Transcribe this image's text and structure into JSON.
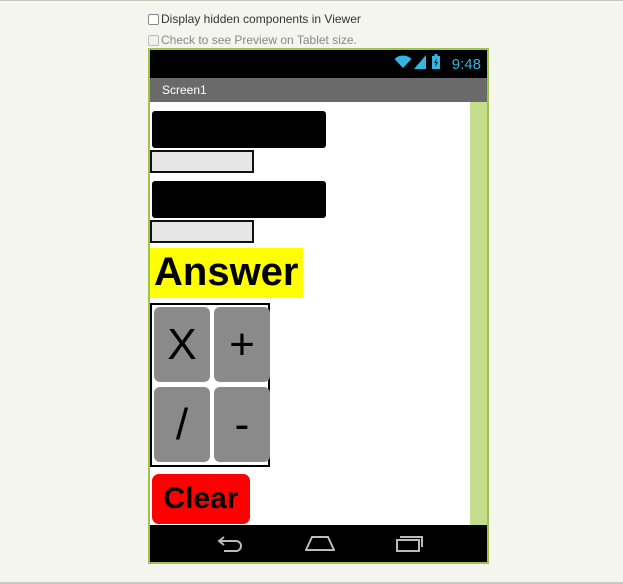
{
  "options": {
    "hidden_components_label": "Display hidden components in Viewer",
    "tablet_preview_label": "Check to see Preview on Tablet size."
  },
  "status_bar": {
    "time": "9:48"
  },
  "screen": {
    "title": "Screen1"
  },
  "content": {
    "answer_label": "Answer",
    "buttons": {
      "multiply": "X",
      "add": "+",
      "divide": "/",
      "subtract": "-"
    },
    "clear_label": "Clear"
  },
  "colors": {
    "accent_green": "#9ec24a",
    "answer_bg": "#ffff00",
    "clear_bg": "#ff0000",
    "op_button_bg": "#8a8a8a",
    "clock": "#33b5e5"
  },
  "icons": [
    "wifi-icon",
    "signal-icon",
    "battery-icon",
    "back-icon",
    "home-icon",
    "recent-apps-icon"
  ]
}
